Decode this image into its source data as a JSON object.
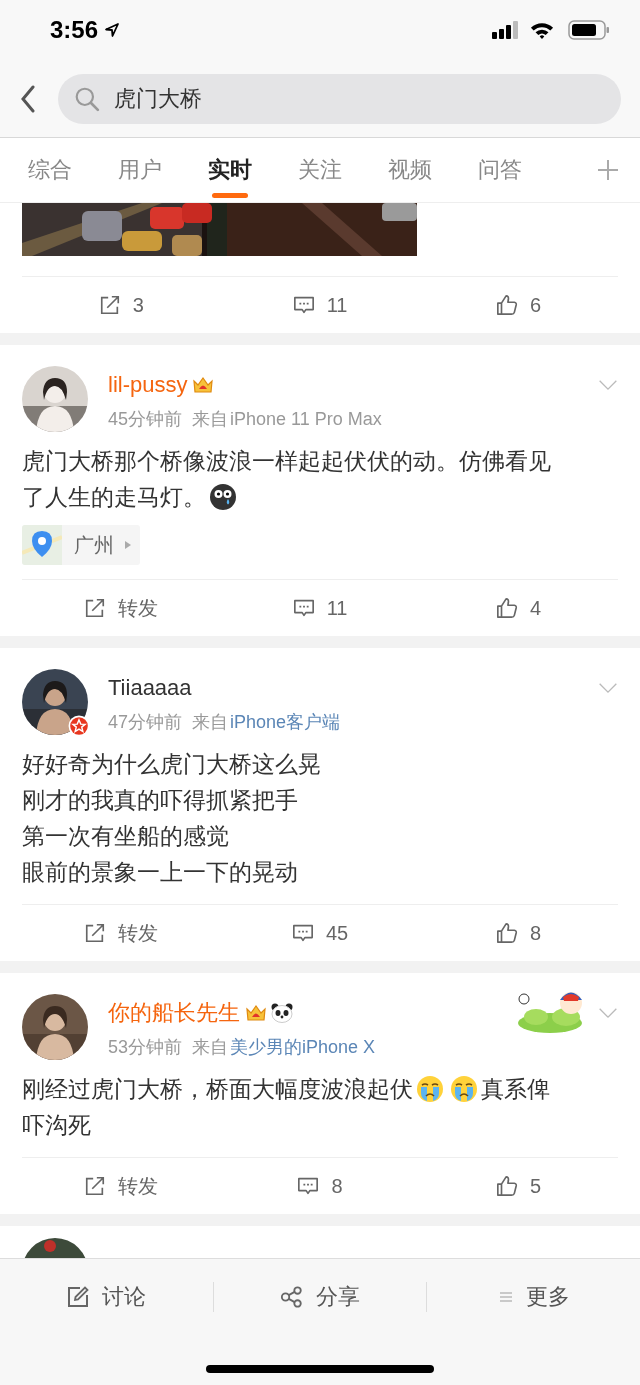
{
  "status_bar": {
    "time": "3:56"
  },
  "search": {
    "value": "虎门大桥"
  },
  "tabs": [
    {
      "label": "综合",
      "selected": false
    },
    {
      "label": "用户",
      "selected": false
    },
    {
      "label": "实时",
      "selected": true
    },
    {
      "label": "关注",
      "selected": false
    },
    {
      "label": "视频",
      "selected": false
    },
    {
      "label": "问答",
      "selected": false
    }
  ],
  "first_post": {
    "actions": {
      "repost": "3",
      "comments": "11",
      "likes": "6"
    }
  },
  "posts": [
    {
      "name": "lil-pussy",
      "vip": true,
      "verified": false,
      "panda_badge": false,
      "time": "45分钟前",
      "source_prefix": "来自",
      "source": "iPhone 11 Pro Max",
      "source_link": false,
      "sticker": false,
      "lines": [
        [
          {
            "kind": "text",
            "text": "虎门大桥那个桥像波浪一样起起伏伏的动。仿佛看见"
          }
        ],
        [
          {
            "kind": "text",
            "text": "了人生的走马灯。"
          },
          {
            "kind": "tearful"
          }
        ]
      ],
      "location": "广州",
      "actions": {
        "repost": "转发",
        "comments": "11",
        "likes": "4"
      }
    },
    {
      "name": "Tiiaaaaa",
      "vip": false,
      "verified": true,
      "panda_badge": false,
      "time": "47分钟前",
      "source_prefix": "来自",
      "source": "iPhone客户端",
      "source_link": true,
      "sticker": false,
      "lines": [
        [
          {
            "kind": "text",
            "text": "好好奇为什么虎门大桥这么晃"
          }
        ],
        [
          {
            "kind": "text",
            "text": "刚才的我真的吓得抓紧把手"
          }
        ],
        [
          {
            "kind": "text",
            "text": "第一次有坐船的感觉"
          }
        ],
        [
          {
            "kind": "text",
            "text": "眼前的景象一上一下的晃动"
          }
        ]
      ],
      "actions": {
        "repost": "转发",
        "comments": "45",
        "likes": "8"
      }
    },
    {
      "name": "你的船长先生",
      "vip": true,
      "verified": false,
      "panda_badge": true,
      "time": "53分钟前",
      "source_prefix": "来自",
      "source": "美少男的iPhone X",
      "source_link": true,
      "sticker": true,
      "lines": [
        [
          {
            "kind": "text",
            "text": "刚经过虎门大桥，桥面大幅度波浪起伏"
          },
          {
            "kind": "crying"
          },
          {
            "kind": "crying"
          },
          {
            "kind": "text",
            "text": "真系俾"
          }
        ],
        [
          {
            "kind": "text",
            "text": "吓沟死"
          }
        ]
      ],
      "actions": {
        "repost": "转发",
        "comments": "8",
        "likes": "5"
      }
    }
  ],
  "bottom_bar": [
    {
      "kind": "discuss",
      "label": "讨论"
    },
    {
      "kind": "share",
      "label": "分享"
    },
    {
      "kind": "more",
      "label": "更多"
    }
  ]
}
